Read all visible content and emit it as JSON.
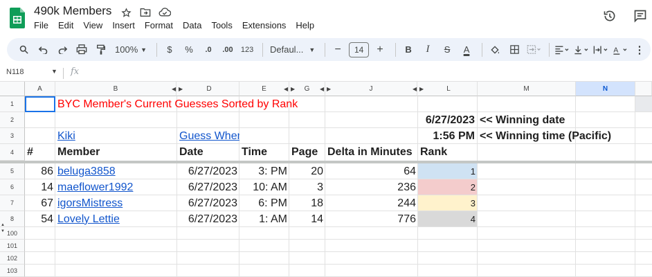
{
  "doc": {
    "title": "490k Members",
    "menu": [
      "File",
      "Edit",
      "View",
      "Insert",
      "Format",
      "Data",
      "Tools",
      "Extensions",
      "Help"
    ]
  },
  "toolbar": {
    "zoom": "100%",
    "currency": "$",
    "percent": "%",
    "decrease_decimals": ".0",
    "increase_decimals": ".00",
    "number_format": "123",
    "font": "Defaul...",
    "font_size": "14",
    "bold": "B",
    "italic": "I",
    "strike": "S",
    "text_color": "A",
    "minus": "−",
    "plus": "+"
  },
  "formula_bar": {
    "cell_ref": "N118",
    "fx": "fx"
  },
  "columns": [
    "A",
    "B",
    "",
    "D",
    "E",
    "G",
    "J",
    "",
    "L",
    "M",
    "N"
  ],
  "rows": [
    "1",
    "2",
    "3",
    "4",
    "5",
    "6",
    "7",
    "8",
    "100",
    "101",
    "102",
    "103"
  ],
  "sheet": {
    "title": "BYC Member's Current Guesses Sorted by Rank",
    "winning_date": "6/27/2023",
    "winning_date_label": "<< Winning date",
    "winning_time": "1:56 PM",
    "winning_time_label": "<< Winning time (Pacific)",
    "link_kiki": "Kiki",
    "link_guess": "Guess When",
    "headers": [
      "#",
      "Member",
      "Date",
      "Time",
      "Page",
      "Delta in Minutes",
      "Rank"
    ],
    "entries": [
      {
        "num": "86",
        "member": "beluga3858",
        "date": "6/27/2023",
        "time": "3: PM",
        "page": "20",
        "delta": "64",
        "rank": "1"
      },
      {
        "num": "14",
        "member": "maeflower1992",
        "date": "6/27/2023",
        "time": "10: AM",
        "page": "3",
        "delta": "236",
        "rank": "2"
      },
      {
        "num": "67",
        "member": "igorsMistress",
        "date": "6/27/2023",
        "time": "6: PM",
        "page": "18",
        "delta": "244",
        "rank": "3"
      },
      {
        "num": "54",
        "member": "Lovely Lettie",
        "date": "6/27/2023",
        "time": "1: AM",
        "page": "14",
        "delta": "776",
        "rank": "4"
      }
    ]
  },
  "colors": {
    "rank_1": "#cfe2f3",
    "rank_2": "#f4cccc",
    "rank_3": "#fff2cc",
    "rank_4": "#d9d9d9",
    "title_red": "#ff0000",
    "link_blue": "#1155cc"
  }
}
